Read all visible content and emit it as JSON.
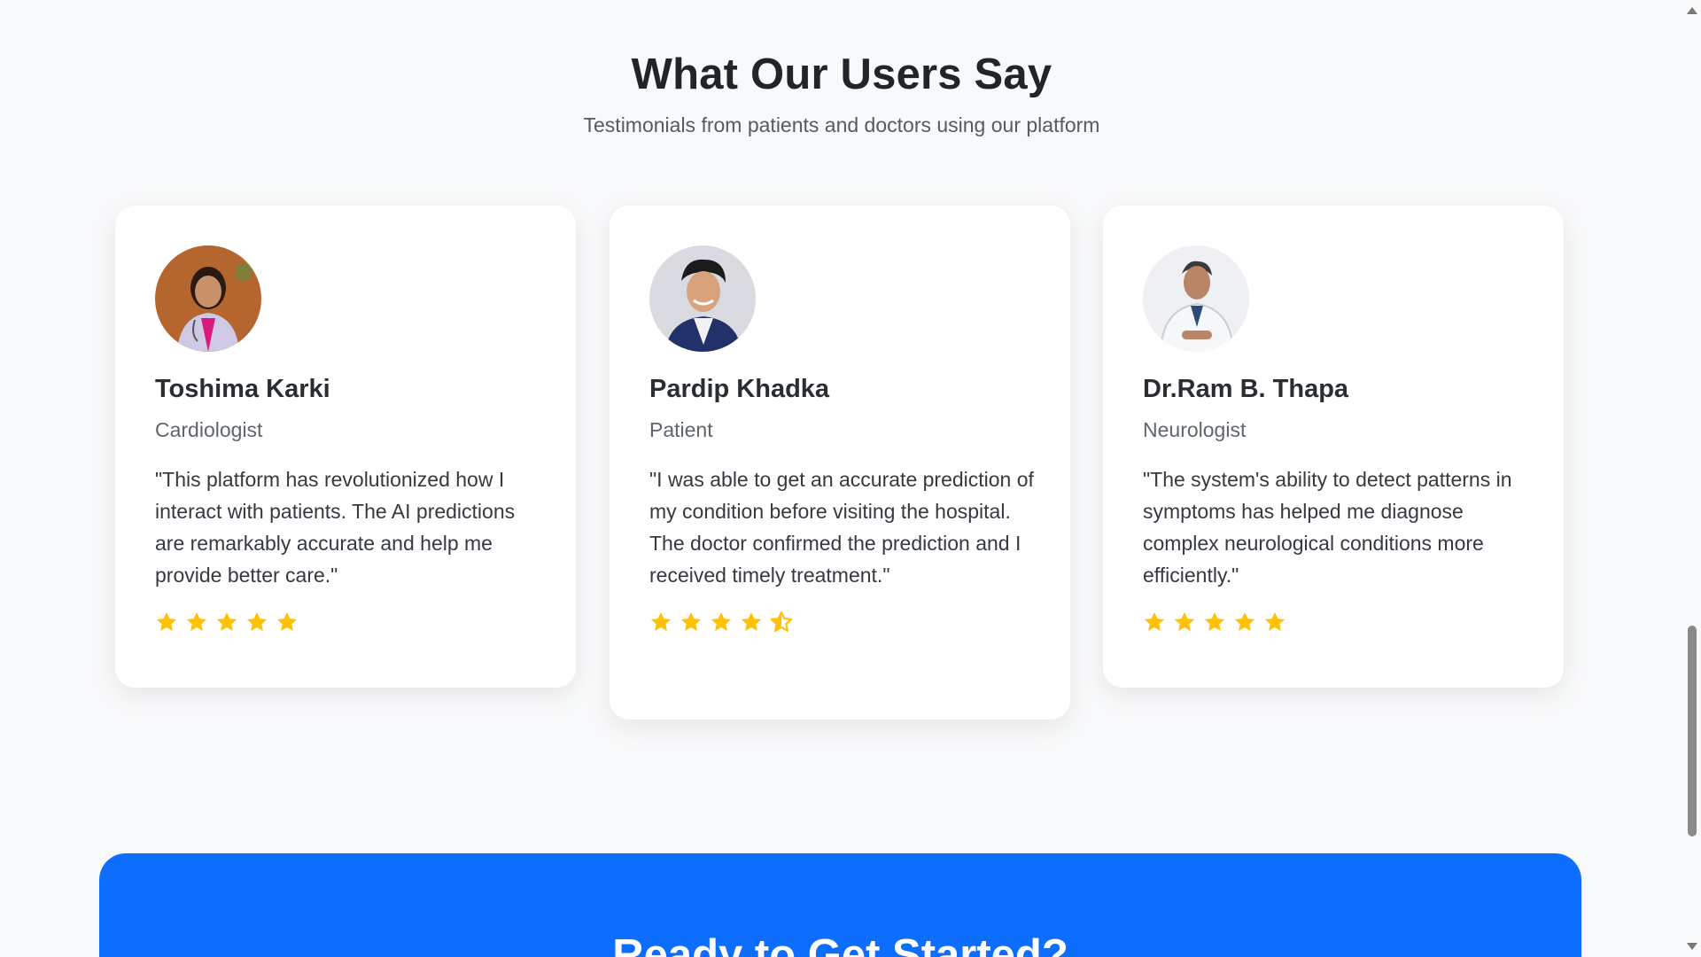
{
  "section": {
    "title": "What Our Users Say",
    "subtitle": "Testimonials from patients and doctors using our platform"
  },
  "testimonials": [
    {
      "name": "Toshima Karki",
      "role": "Cardiologist",
      "quote": "\"This platform has revolutionized how I interact with patients. The AI predictions are remarkably accurate and help me provide better care.\"",
      "rating": 5
    },
    {
      "name": "Pardip Khadka",
      "role": "Patient",
      "quote": "\"I was able to get an accurate prediction of my condition before visiting the hospital. The doctor confirmed the prediction and I received timely treatment.\"",
      "rating": 4.5
    },
    {
      "name": "Dr.Ram B. Thapa",
      "role": "Neurologist",
      "quote": "\"The system's ability to detect patterns in symptoms has helped me diagnose complex neurological conditions more efficiently.\"",
      "rating": 5
    }
  ],
  "cta": {
    "title": "Ready to Get Started?"
  },
  "colors": {
    "star": "#ffc107",
    "cta_background": "#0d6efd"
  },
  "icons": {
    "star": "star-icon",
    "half_star": "star-half-icon"
  }
}
